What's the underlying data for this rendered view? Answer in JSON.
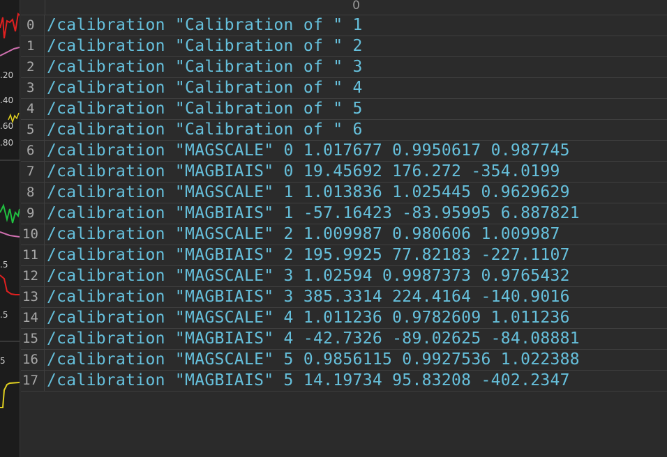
{
  "column_header": "0",
  "rows": [
    {
      "index": "0",
      "value": "/calibration \"Calibration of \" 1"
    },
    {
      "index": "1",
      "value": "/calibration \"Calibration of \" 2"
    },
    {
      "index": "2",
      "value": "/calibration \"Calibration of \" 3"
    },
    {
      "index": "3",
      "value": "/calibration \"Calibration of \" 4"
    },
    {
      "index": "4",
      "value": "/calibration \"Calibration of \" 5"
    },
    {
      "index": "5",
      "value": "/calibration \"Calibration of \" 6"
    },
    {
      "index": "6",
      "value": "/calibration \"MAGSCALE\" 0 1.017677 0.9950617 0.987745"
    },
    {
      "index": "7",
      "value": "/calibration \"MAGBIAIS\" 0 19.45692 176.272 -354.0199"
    },
    {
      "index": "8",
      "value": "/calibration \"MAGSCALE\" 1 1.013836 1.025445 0.9629629"
    },
    {
      "index": "9",
      "value": "/calibration \"MAGBIAIS\" 1 -57.16423 -83.95995 6.887821"
    },
    {
      "index": "10",
      "value": "/calibration \"MAGSCALE\" 2 1.009987 0.980606 1.009987"
    },
    {
      "index": "11",
      "value": "/calibration \"MAGBIAIS\" 2 195.9925 77.82183 -227.1107"
    },
    {
      "index": "12",
      "value": "/calibration \"MAGSCALE\" 3 1.02594 0.9987373 0.9765432"
    },
    {
      "index": "13",
      "value": "/calibration \"MAGBIAIS\" 3 385.3314 224.4164 -140.9016"
    },
    {
      "index": "14",
      "value": "/calibration \"MAGSCALE\" 4 1.011236 0.9782609 1.011236"
    },
    {
      "index": "15",
      "value": "/calibration \"MAGBIAIS\" 4 -42.7326 -89.02625 -84.08881"
    },
    {
      "index": "16",
      "value": "/calibration \"MAGSCALE\" 5 0.9856115 0.9927536 1.022388"
    },
    {
      "index": "17",
      "value": "/calibration \"MAGBIAIS\" 5 14.19734 95.83208 -402.2347"
    }
  ],
  "left_strip": {
    "tick_labels": [
      ".20",
      ".40",
      ".60",
      ".80",
      ".5",
      ".5",
      "5"
    ]
  },
  "colors": {
    "cell_text": "#66c0dc",
    "index_text": "#a8a8a8",
    "background": "#2b2b2b",
    "grid": "#3f3f3f"
  }
}
